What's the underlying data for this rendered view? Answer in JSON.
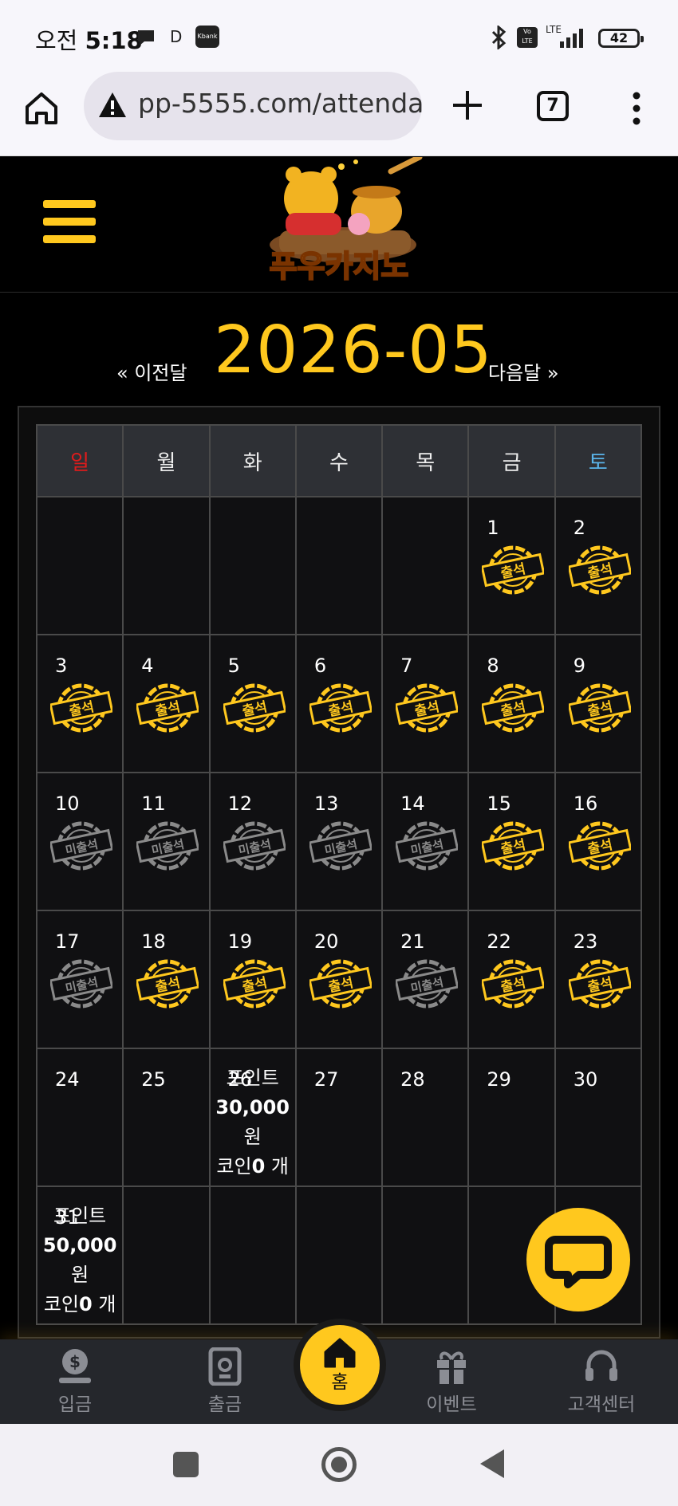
{
  "status_bar": {
    "time_prefix": "오전",
    "time": "5:18",
    "carrier_letter": "D",
    "app_badge": "Kbank",
    "network": "LTE",
    "battery": "42"
  },
  "browser": {
    "url": "pp-5555.com/attendan",
    "tab_count": "7"
  },
  "site": {
    "logo_text": "푸우카지노"
  },
  "calendar": {
    "prev_label": "« 이전달",
    "month_title": "2026-05",
    "next_label": "다음달 »",
    "weekdays": [
      "일",
      "월",
      "화",
      "수",
      "목",
      "금",
      "토"
    ],
    "stamp_attended": "출석",
    "stamp_missed": "미출석",
    "weeks": [
      [
        null,
        null,
        null,
        null,
        null,
        {
          "day": "1",
          "status": "attended"
        },
        {
          "day": "2",
          "status": "attended"
        }
      ],
      [
        {
          "day": "3",
          "status": "attended"
        },
        {
          "day": "4",
          "status": "attended"
        },
        {
          "day": "5",
          "status": "attended"
        },
        {
          "day": "6",
          "status": "attended"
        },
        {
          "day": "7",
          "status": "attended"
        },
        {
          "day": "8",
          "status": "attended"
        },
        {
          "day": "9",
          "status": "attended"
        }
      ],
      [
        {
          "day": "10",
          "status": "missed"
        },
        {
          "day": "11",
          "status": "missed"
        },
        {
          "day": "12",
          "status": "missed"
        },
        {
          "day": "13",
          "status": "missed"
        },
        {
          "day": "14",
          "status": "missed"
        },
        {
          "day": "15",
          "status": "attended"
        },
        {
          "day": "16",
          "status": "attended"
        }
      ],
      [
        {
          "day": "17",
          "status": "missed"
        },
        {
          "day": "18",
          "status": "attended"
        },
        {
          "day": "19",
          "status": "attended"
        },
        {
          "day": "20",
          "status": "attended"
        },
        {
          "day": "21",
          "status": "missed"
        },
        {
          "day": "22",
          "status": "attended"
        },
        {
          "day": "23",
          "status": "attended"
        }
      ],
      [
        {
          "day": "24"
        },
        {
          "day": "25"
        },
        {
          "day": "26",
          "reward": {
            "l1": "포인트",
            "amount": "30,000",
            "unit": "원",
            "coin_pre": "코인",
            "coin_num": "0",
            "coin_post": " 개"
          }
        },
        {
          "day": "27"
        },
        {
          "day": "28"
        },
        {
          "day": "29"
        },
        {
          "day": "30"
        }
      ],
      [
        {
          "day": "31",
          "reward": {
            "l1": "포인트",
            "amount": "50,000",
            "unit": "원",
            "coin_pre": "코인",
            "coin_num": "0",
            "coin_post": " 개"
          }
        },
        null,
        null,
        null,
        null,
        null,
        null
      ]
    ]
  },
  "bottom_nav": {
    "deposit": "입금",
    "withdraw": "출금",
    "home": "홈",
    "event": "이벤트",
    "support": "고객센터"
  },
  "colors": {
    "accent": "#ffc81e",
    "sunday": "#e01b1b",
    "saturday": "#5ab4ea",
    "stamp_missed": "#8a8a8a"
  }
}
